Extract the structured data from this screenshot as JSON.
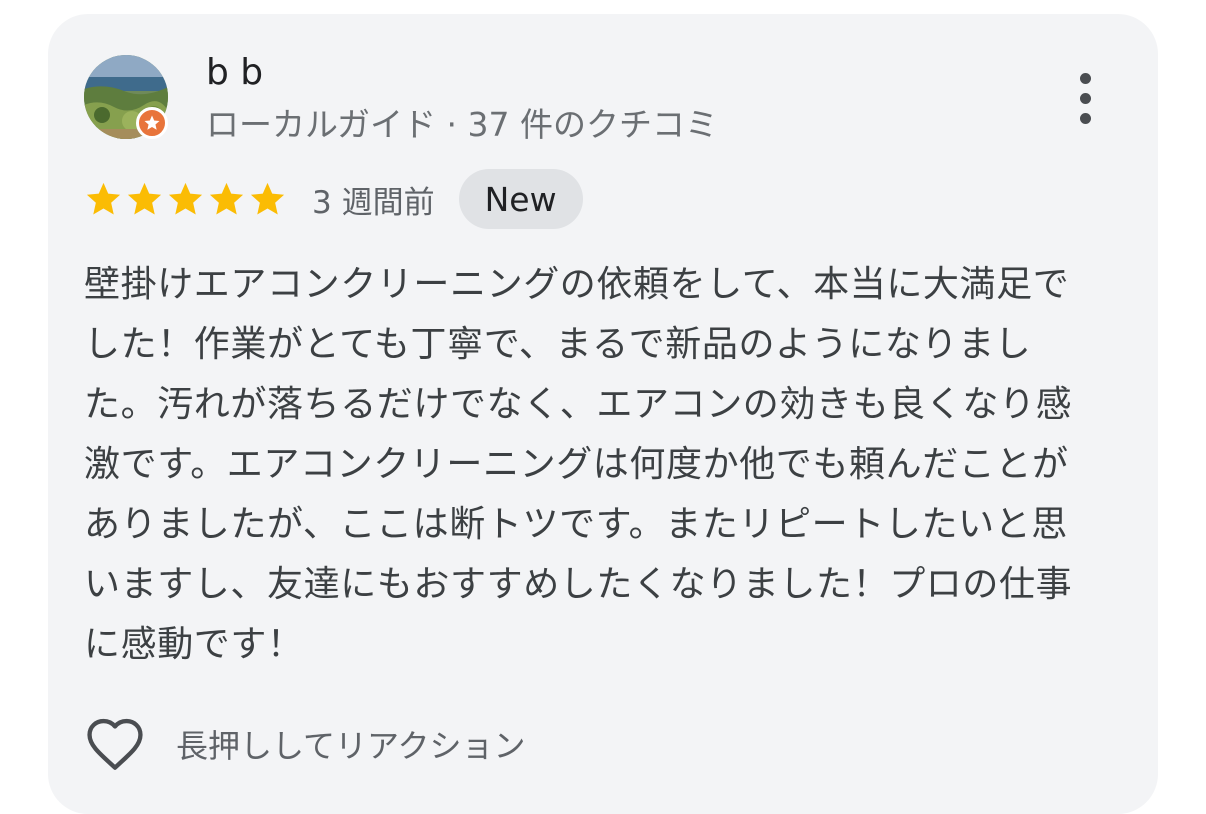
{
  "review": {
    "author": {
      "name": "b b",
      "subtitle": "ローカルガイド · 37 件のクチコミ",
      "avatar_icon": "avatar-photo-coastline",
      "badge_icon": "local-guide-star-badge",
      "badge_color": "#e8743b"
    },
    "menu_icon": "more-vert-icon",
    "rating": {
      "stars": 5,
      "max": 5,
      "star_color": "#fbbc04"
    },
    "time_ago": "3 週間前",
    "badge": "New",
    "text": "壁掛けエアコンクリーニングの依頼をして、本当に大満足でした！作業がとても丁寧で、まるで新品のようになりました。汚れが落ちるだけでなく、エアコンの効きも良くなり感激です。エアコンクリーニングは何度か他でも頼んだことがありましたが、ここは断トツです。またリピートしたいと思いますし、友達にもおすすめしたくなりました！プロの仕事に感動です！",
    "reaction": {
      "icon": "heart-outline-icon",
      "label": "長押ししてリアクション"
    }
  }
}
